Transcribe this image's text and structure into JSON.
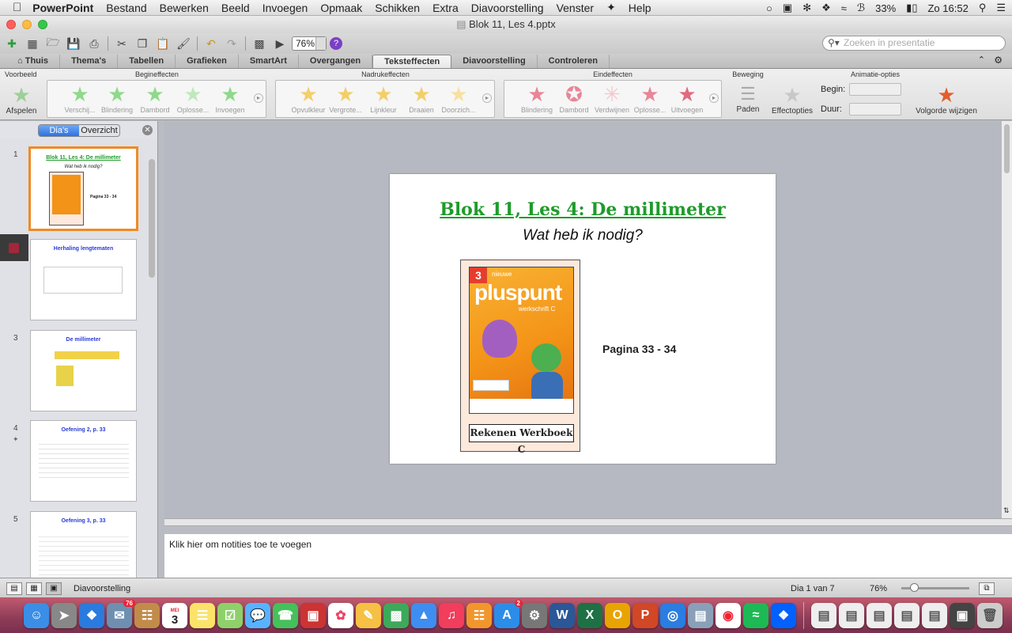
{
  "menubar": {
    "app": "PowerPoint",
    "items": [
      "Bestand",
      "Bewerken",
      "Beeld",
      "Invoegen",
      "Opmaak",
      "Schikken",
      "Extra",
      "Diavoorstelling",
      "Venster",
      "Help"
    ],
    "battery": "33%",
    "clock": "Zo 16:52"
  },
  "window": {
    "title": "Blok 11, Les 4.pptx"
  },
  "toolbar": {
    "zoom": "76%",
    "search_placeholder": "Zoeken in presentatie"
  },
  "ribbon": {
    "tabs": [
      "Thuis",
      "Thema's",
      "Tabellen",
      "Grafieken",
      "SmartArt",
      "Overgangen",
      "Teksteffecten",
      "Diavoorstelling",
      "Controleren"
    ],
    "active_tab": "Teksteffecten",
    "preview_group": "Voorbeeld",
    "play_label": "Afspelen",
    "groups": [
      {
        "title": "Begineffecten",
        "items": [
          "Verschij...",
          "Blindering",
          "Dambord",
          "Oplosse...",
          "Invoegen"
        ],
        "color": "#6fd36a"
      },
      {
        "title": "Nadrukeffecten",
        "items": [
          "Opvulkleur",
          "Vergrote...",
          "Lijnkleur",
          "Draaien",
          "Doorzich..."
        ],
        "color": "#f0c040"
      },
      {
        "title": "Eindeffecten",
        "items": [
          "Blindering",
          "Dambord",
          "Verdwijnen",
          "Oplosse...",
          "Uitvoegen"
        ],
        "color": "#e0506a"
      }
    ],
    "motion_group": "Beweging",
    "paths_label": "Paden",
    "options_group": "Animatie-opties",
    "effect_options_label": "Effectopties",
    "begin_label": "Begin:",
    "duration_label": "Duur:",
    "reorder_label": "Volgorde wijzigen"
  },
  "leftpane": {
    "tab_slides": "Dia's",
    "tab_outline": "Overzicht",
    "thumbs": [
      {
        "num": "1",
        "title": "Blok 11, Les 4: De millimeter"
      },
      {
        "num": "",
        "title": "Herhaling lengtematen"
      },
      {
        "num": "3",
        "title": "De millimeter"
      },
      {
        "num": "4",
        "title": "Oefening 2, p. 33"
      },
      {
        "num": "5",
        "title": "Oefening 3, p. 33"
      }
    ]
  },
  "slide": {
    "title": "Blok 11, Les 4: De millimeter",
    "subtitle": "Wat heb ik nodig?",
    "cover_brand_small": "nieuwe",
    "cover_brand": "pluspunt",
    "cover_grade": "3",
    "cover_sub": "werkschrift C",
    "book_label": "Rekenen Werkboek C",
    "pagina": "Pagina 33 -  34"
  },
  "notes": {
    "placeholder": "Klik hier om notities toe te voegen"
  },
  "statusbar": {
    "view": "Diavoorstelling",
    "slide_of": "Dia 1 van 7",
    "zoom": "76%"
  },
  "dock": {
    "mail_badge": "76",
    "calendar_month": "MEI",
    "calendar_day": "3",
    "appstore_badge": "2"
  }
}
